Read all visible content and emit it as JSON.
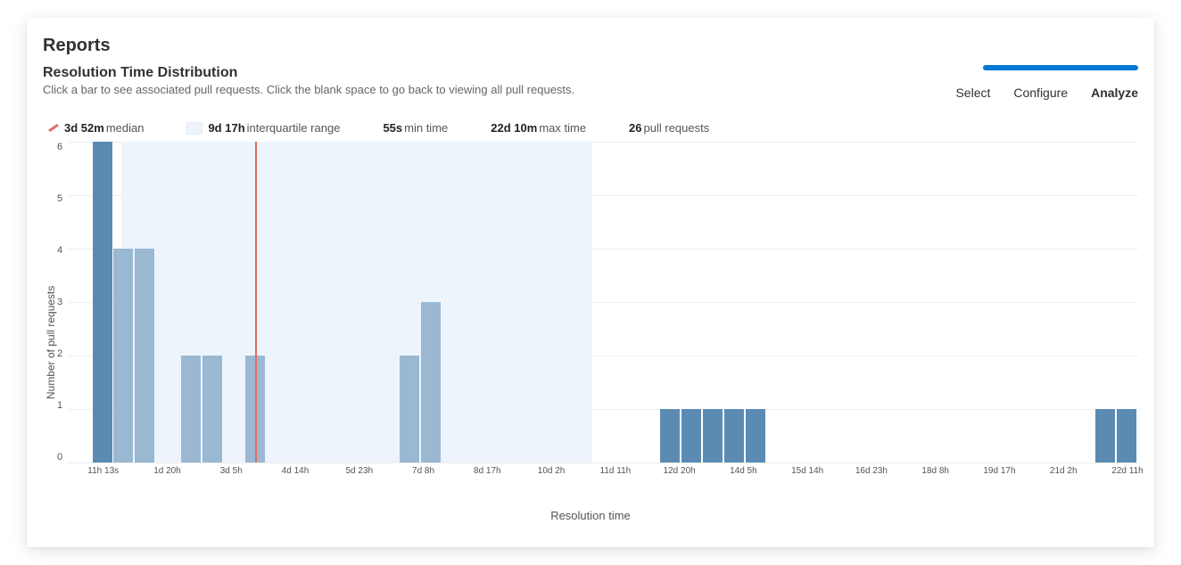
{
  "page_title": "Reports",
  "section_title": "Resolution Time Distribution",
  "section_desc": "Click a bar to see associated pull requests. Click the blank space to go back to viewing all pull requests.",
  "tabs": {
    "select": "Select",
    "configure": "Configure",
    "analyze": "Analyze"
  },
  "stats": {
    "median_value": "3d 52m",
    "median_label": "median",
    "iqr_value": "9d 17h",
    "iqr_label": "interquartile range",
    "min_value": "55s",
    "min_label": "min time",
    "max_value": "22d 10m",
    "max_label": "max time",
    "count_value": "26",
    "count_label": "pull requests"
  },
  "chart_data": {
    "type": "bar",
    "xlabel": "Resolution time",
    "ylabel": "Number of pull requests",
    "ylim": [
      0,
      6
    ],
    "yticks": [
      0,
      1,
      2,
      3,
      4,
      5,
      6
    ],
    "x_tick_labels": [
      "11h 13s",
      "1d 20h",
      "3d 5h",
      "4d 14h",
      "5d 23h",
      "7d 8h",
      "8d 17h",
      "10d 2h",
      "11d 11h",
      "12d 20h",
      "14d 5h",
      "15d 14h",
      "16d 23h",
      "18d 8h",
      "19d 17h",
      "21d 2h",
      "22d 11h"
    ],
    "bars": [
      {
        "pos": 0.023,
        "value": 6,
        "dark": true
      },
      {
        "pos": 0.042,
        "value": 4,
        "dark": false
      },
      {
        "pos": 0.062,
        "value": 4,
        "dark": false
      },
      {
        "pos": 0.106,
        "value": 2,
        "dark": false
      },
      {
        "pos": 0.126,
        "value": 2,
        "dark": false
      },
      {
        "pos": 0.166,
        "value": 2,
        "dark": false
      },
      {
        "pos": 0.31,
        "value": 2,
        "dark": false
      },
      {
        "pos": 0.33,
        "value": 3,
        "dark": false
      },
      {
        "pos": 0.553,
        "value": 1,
        "dark": true
      },
      {
        "pos": 0.573,
        "value": 1,
        "dark": true
      },
      {
        "pos": 0.593,
        "value": 1,
        "dark": true
      },
      {
        "pos": 0.613,
        "value": 1,
        "dark": true
      },
      {
        "pos": 0.633,
        "value": 1,
        "dark": true
      },
      {
        "pos": 0.96,
        "value": 1,
        "dark": true
      },
      {
        "pos": 0.98,
        "value": 1,
        "dark": true
      }
    ],
    "iqr_band": {
      "start": 0.05,
      "end": 0.49
    },
    "median_pos": 0.175,
    "bar_width_frac": 0.0185
  }
}
